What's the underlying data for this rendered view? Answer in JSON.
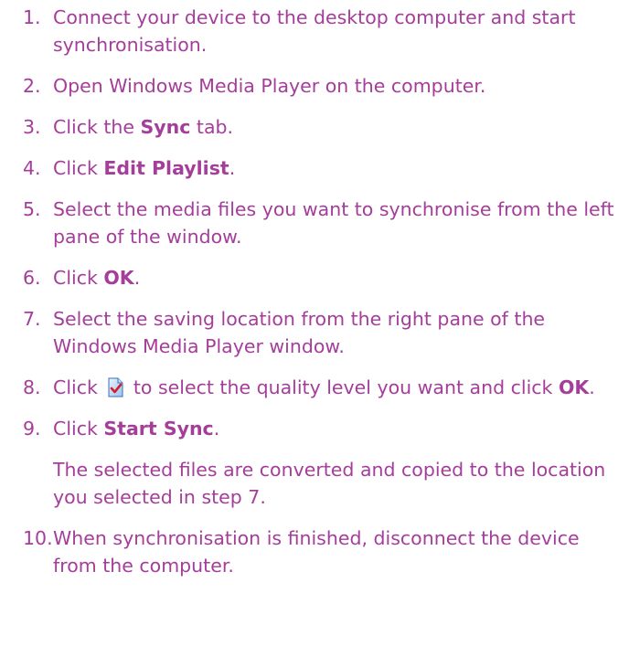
{
  "steps": [
    {
      "num": "1.",
      "parts": [
        "Connect your device to the desktop computer and start synchronisation."
      ]
    },
    {
      "num": "2.",
      "parts": [
        "Open Windows Media Player on the computer."
      ]
    },
    {
      "num": "3.",
      "pre": "Click the ",
      "bold": "Sync",
      "post": " tab."
    },
    {
      "num": "4.",
      "pre": "Click ",
      "bold": "Edit Playlist",
      "post": "."
    },
    {
      "num": "5.",
      "parts": [
        "Select the media files you want to synchronise from the left pane of the window."
      ]
    },
    {
      "num": "6.",
      "pre": "Click ",
      "bold": "OK",
      "post": "."
    },
    {
      "num": "7.",
      "parts": [
        "Select the saving location from the right pane of the Windows Media Player window."
      ]
    },
    {
      "num": "8.",
      "pre": "Click ",
      "icon": "quality-settings-icon",
      "mid": " to select the quality level you want and click ",
      "bold": "OK",
      "post": "."
    },
    {
      "num": "9.",
      "pre": "Click ",
      "bold": "Start Sync",
      "post": "."
    },
    {
      "num": "10.",
      "parts": [
        "When synchronisation is finished, disconnect the device from the computer."
      ]
    }
  ],
  "note_after_step_9": "The selected files are converted and copied to the location you selected in step 7.",
  "colors": {
    "text": "#a53d9a"
  }
}
